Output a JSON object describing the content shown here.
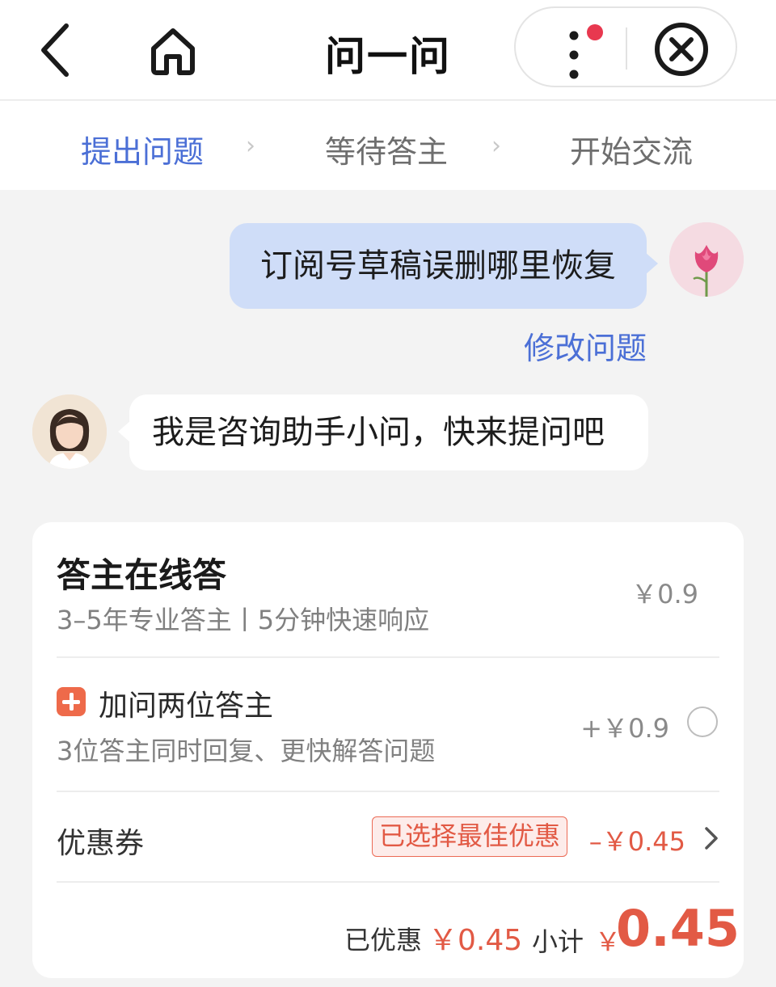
{
  "header": {
    "title": "问一问"
  },
  "steps": [
    {
      "label": "提出问题",
      "active": true
    },
    {
      "label": "等待答主",
      "active": false
    },
    {
      "label": "开始交流",
      "active": false
    }
  ],
  "step_arrow": "›",
  "chat": {
    "user_question": "订阅号草稿误删哪里恢复",
    "edit_link": "修改问题",
    "bot_message": "我是咨询助手小问，快来提问吧"
  },
  "card": {
    "title": "答主在线答",
    "subtitle": "3–5年专业答主丨5分钟快速响应",
    "base_price": "￥0.9",
    "addon": {
      "title": "加问两位答主",
      "subtitle": "3位答主同时回复、更快解答问题",
      "price": "+￥0.9"
    },
    "coupon": {
      "label": "优惠券",
      "badge": "已选择最佳优惠",
      "amount": "–￥0.45"
    },
    "summary": {
      "saved_label": "已优惠",
      "saved_amount": "￥0.45",
      "subtotal_label": "小计",
      "subtotal_currency": "￥",
      "subtotal_amount": "0.45"
    }
  },
  "colors": {
    "accent_blue": "#4b6fd6",
    "price_red": "#e25a45",
    "user_bubble": "#cfddf8",
    "notification_dot": "#e8384f"
  },
  "icons": [
    "back-arrow-icon",
    "home-icon",
    "more-dots-icon",
    "notification-dot",
    "close-circle-icon",
    "plus-icon",
    "chevron-right-icon"
  ]
}
